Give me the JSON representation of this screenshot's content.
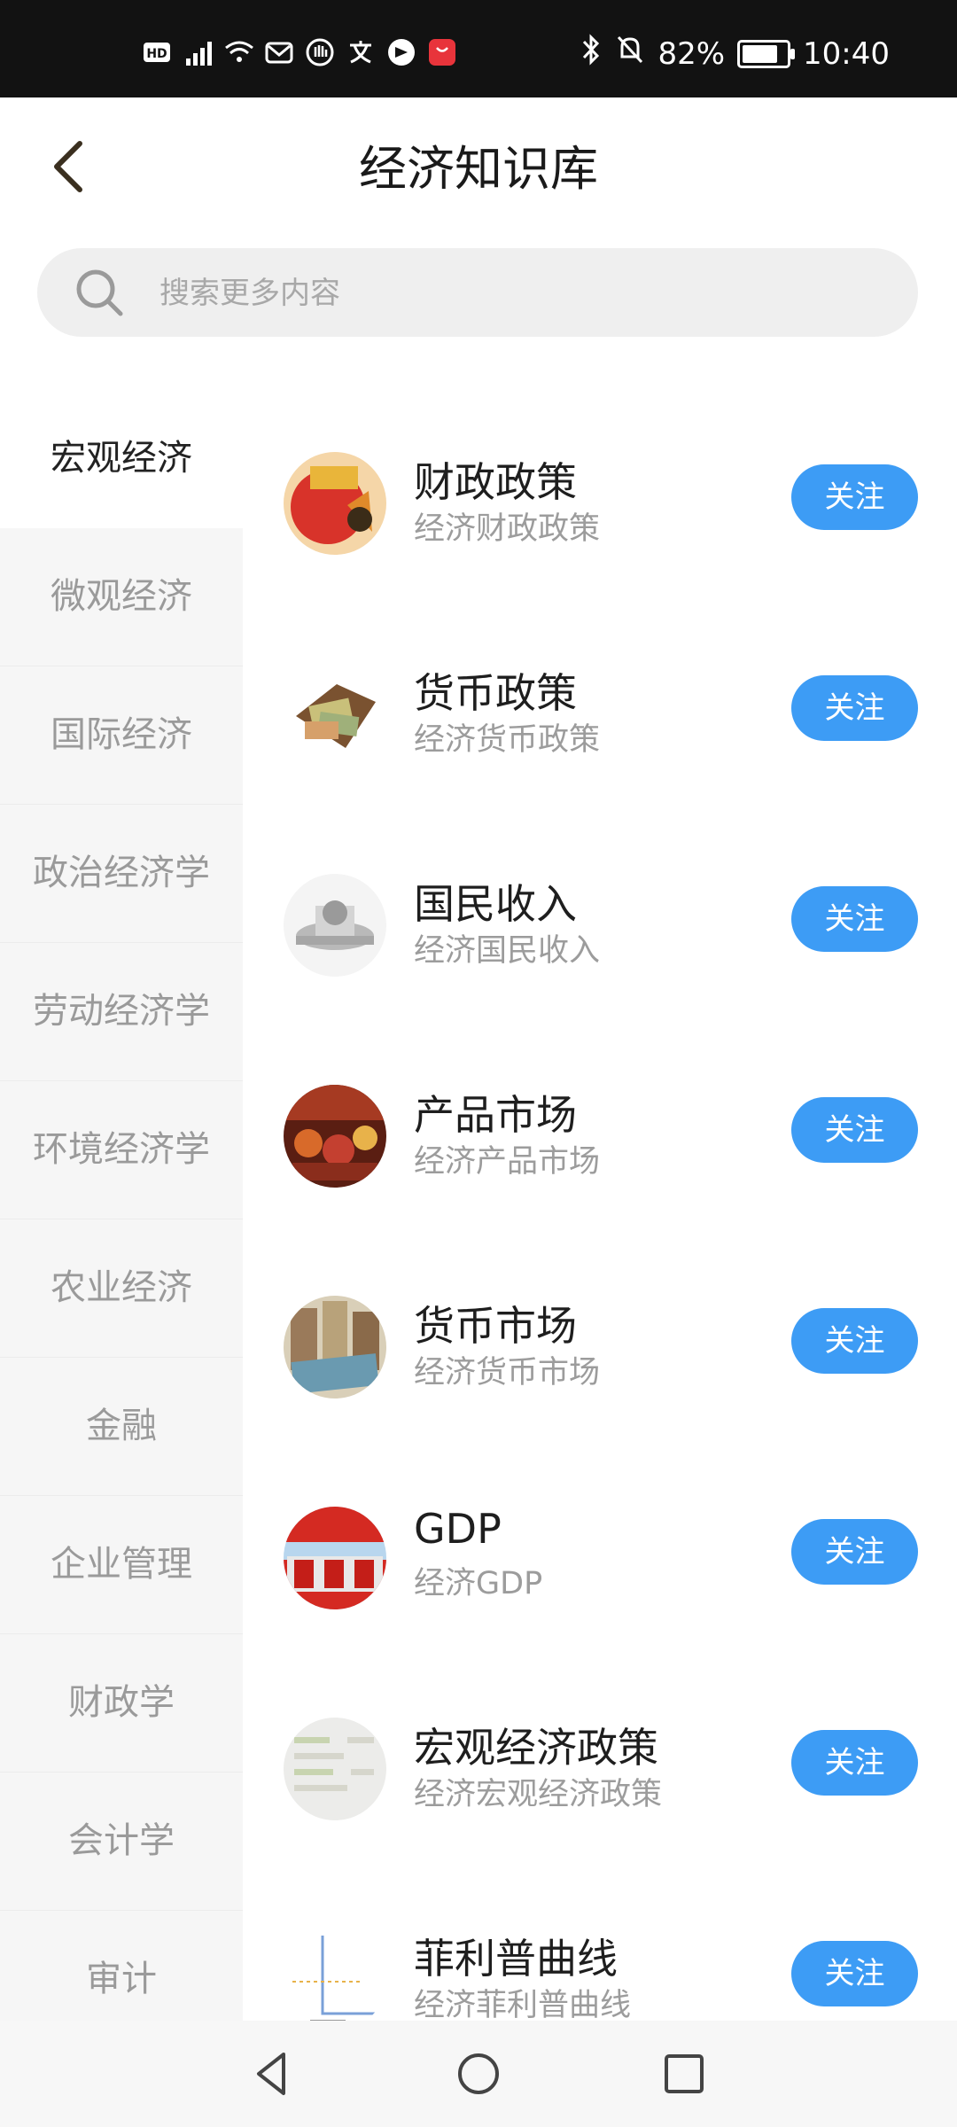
{
  "status_bar": {
    "left_icons": [
      "hd-icon",
      "signal-4g-icon",
      "wifi-icon",
      "mail-icon",
      "hand-icon",
      "translate-icon",
      "app-icon",
      "huawei-store-icon"
    ],
    "battery": "82%",
    "battery_level": 0.82,
    "time": "10:40"
  },
  "header": {
    "title": "经济知识库"
  },
  "search": {
    "placeholder": "搜索更多内容"
  },
  "sidebar": {
    "items": [
      {
        "label": "宏观经济",
        "active": true
      },
      {
        "label": "微观经济"
      },
      {
        "label": "国际经济"
      },
      {
        "label": "政治经济学"
      },
      {
        "label": "劳动经济学"
      },
      {
        "label": "环境经济学"
      },
      {
        "label": "农业经济"
      },
      {
        "label": "金融"
      },
      {
        "label": "企业管理"
      },
      {
        "label": "财政学"
      },
      {
        "label": "会计学"
      },
      {
        "label": "审计"
      }
    ]
  },
  "list": {
    "follow_label": "关注",
    "items": [
      {
        "title": "财政政策",
        "subtitle": "经济财政政策",
        "icon": "fiscal-policy-thumb"
      },
      {
        "title": "货币政策",
        "subtitle": "经济货币政策",
        "icon": "monetary-policy-thumb"
      },
      {
        "title": "国民收入",
        "subtitle": "经济国民收入",
        "icon": "national-income-thumb"
      },
      {
        "title": "产品市场",
        "subtitle": "经济产品市场",
        "icon": "product-market-thumb"
      },
      {
        "title": "货币市场",
        "subtitle": "经济货币市场",
        "icon": "money-market-thumb"
      },
      {
        "title": "GDP",
        "subtitle": "经济GDP",
        "icon": "gdp-thumb"
      },
      {
        "title": "宏观经济政策",
        "subtitle": "经济宏观经济政策",
        "icon": "macro-policy-thumb"
      },
      {
        "title": "菲利普曲线",
        "subtitle": "经济菲利普曲线",
        "icon": "phillips-curve-thumb"
      }
    ]
  },
  "colors": {
    "accent": "#3d9cf5",
    "status_bar": "#121212",
    "sidebar_bg": "#f6f6f6"
  },
  "nav_bar": {
    "buttons": [
      "back-icon",
      "home-icon",
      "recents-icon"
    ]
  }
}
